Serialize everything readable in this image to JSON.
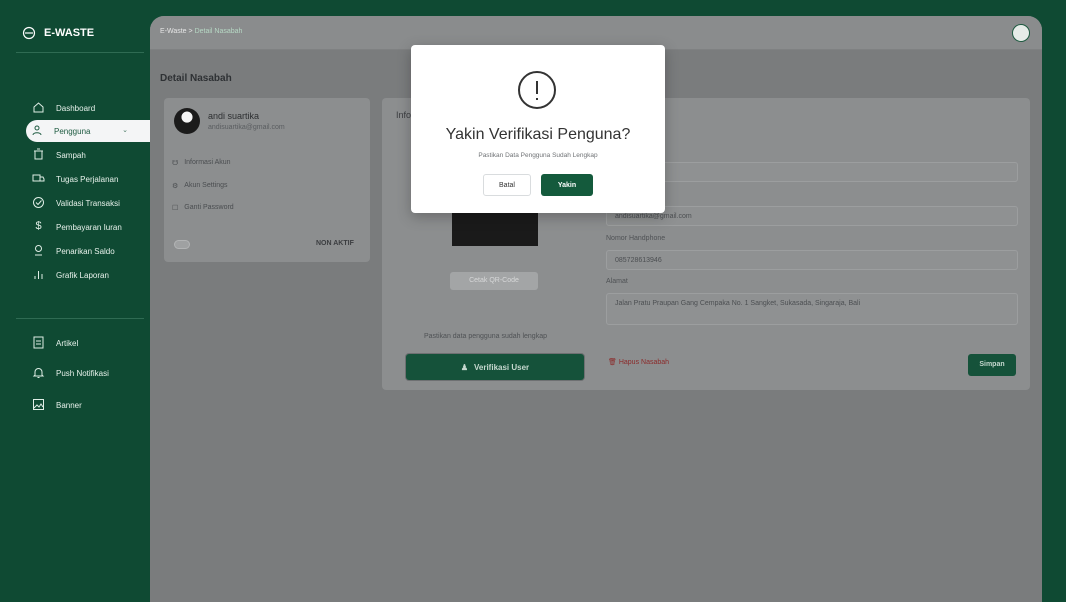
{
  "sidebar": {
    "brand": "E-WASTE",
    "items": [
      {
        "label": "Dashboard",
        "icon": "home-icon"
      },
      {
        "label": "Pengguna",
        "icon": "users-icon"
      },
      {
        "label": "Sampah",
        "icon": "trash-icon"
      },
      {
        "label": "Tugas Perjalanan",
        "icon": "truck-icon"
      },
      {
        "label": "Validasi Transaksi",
        "icon": "check-circle-icon"
      },
      {
        "label": "Pembayaran Iuran",
        "icon": "dollar-icon"
      },
      {
        "label": "Penarikan Saldo",
        "icon": "wallet-icon"
      },
      {
        "label": "Grafik Laporan",
        "icon": "chart-icon"
      },
      {
        "label": "Artikel",
        "icon": "document-icon"
      },
      {
        "label": "Push Notifikasi",
        "icon": "bell-icon"
      },
      {
        "label": "Banner",
        "icon": "image-icon"
      }
    ]
  },
  "header": {
    "breadcrumb_root": "E-Waste",
    "breadcrumb_sep": ">",
    "breadcrumb_current": "Detail Nasabah"
  },
  "page": {
    "title": "Detail Nasabah",
    "profile": {
      "name": "andi suartika",
      "email": "andisuartika@gmail.com",
      "menu": [
        "Informasi Akun",
        "Akun Settings",
        "Ganti Password"
      ],
      "status": "NON AKTIF"
    },
    "info": {
      "title": "Info",
      "email_value": "andisuartika@gmail.com",
      "phone_label": "Nomor Handphone",
      "phone_value": "085728613946",
      "address_label": "Alamat",
      "address_value": "Jalan Pratu Praupan Gang Cempaka No. 1 Sangket, Sukasada, Singaraja, Bali",
      "qr_button": "Cetak QR-Code",
      "hint": "Pastikan data pengguna sudah lengkap",
      "verify_button": "Verifikasi User",
      "delete_link": "Hapus Nasabah",
      "save_button": "Simpan"
    }
  },
  "modal": {
    "title": "Yakin Verifikasi Penguna?",
    "subtitle": "Pastikan Data Pengguna Sudah Lengkap",
    "cancel": "Batal",
    "confirm": "Yakin"
  },
  "colors": {
    "primary": "#0f4a33",
    "button": "#145a3c",
    "danger": "#8b2a2a"
  }
}
